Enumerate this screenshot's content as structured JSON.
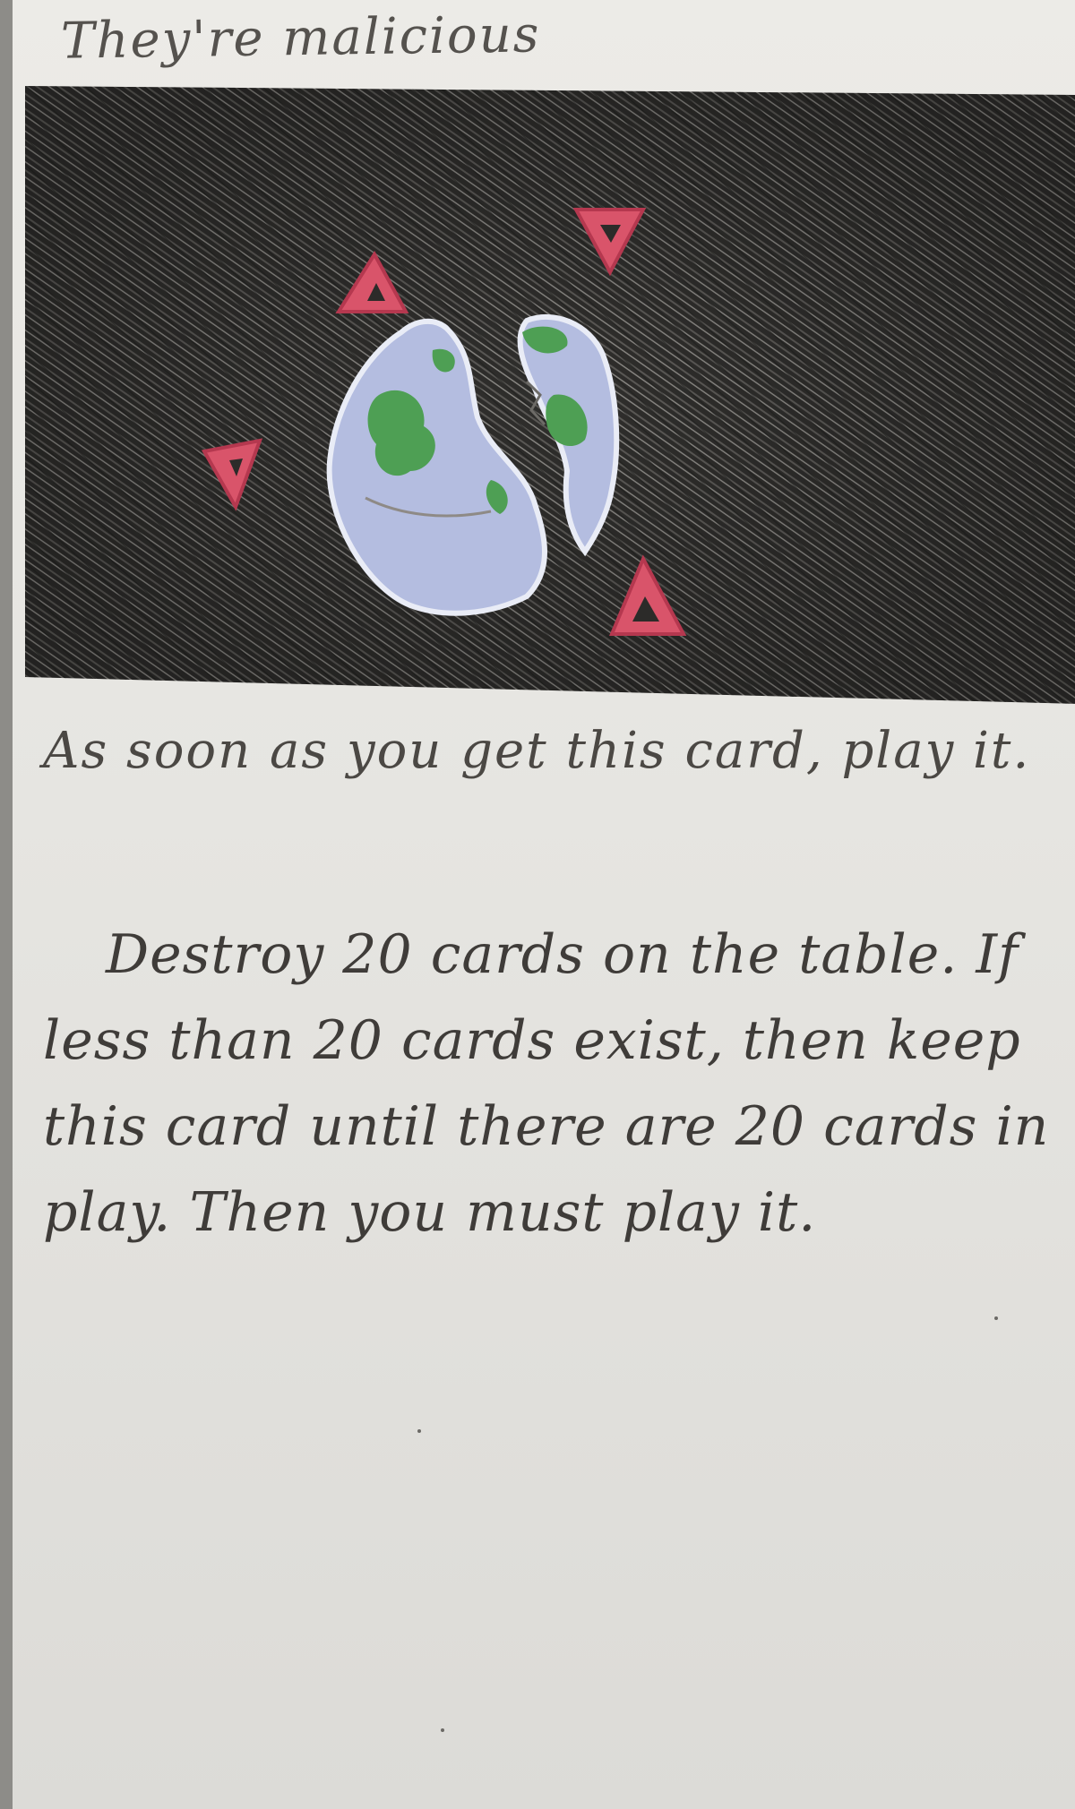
{
  "card": {
    "title": "They're malicious",
    "instruction": "As soon as you get this card, play it.",
    "effect": "Destroy 20 cards on the table. If less than 20 cards exist, then keep this card until there are 20 cards in play. Then you must play it."
  },
  "art": {
    "depiction": "cracked-earth-with-warning-triangles",
    "colors": {
      "background": "#3b3a38",
      "earth_blue": "#aeb8dc",
      "earth_green": "#4d9e52",
      "warning_red": "#d9546a"
    }
  }
}
